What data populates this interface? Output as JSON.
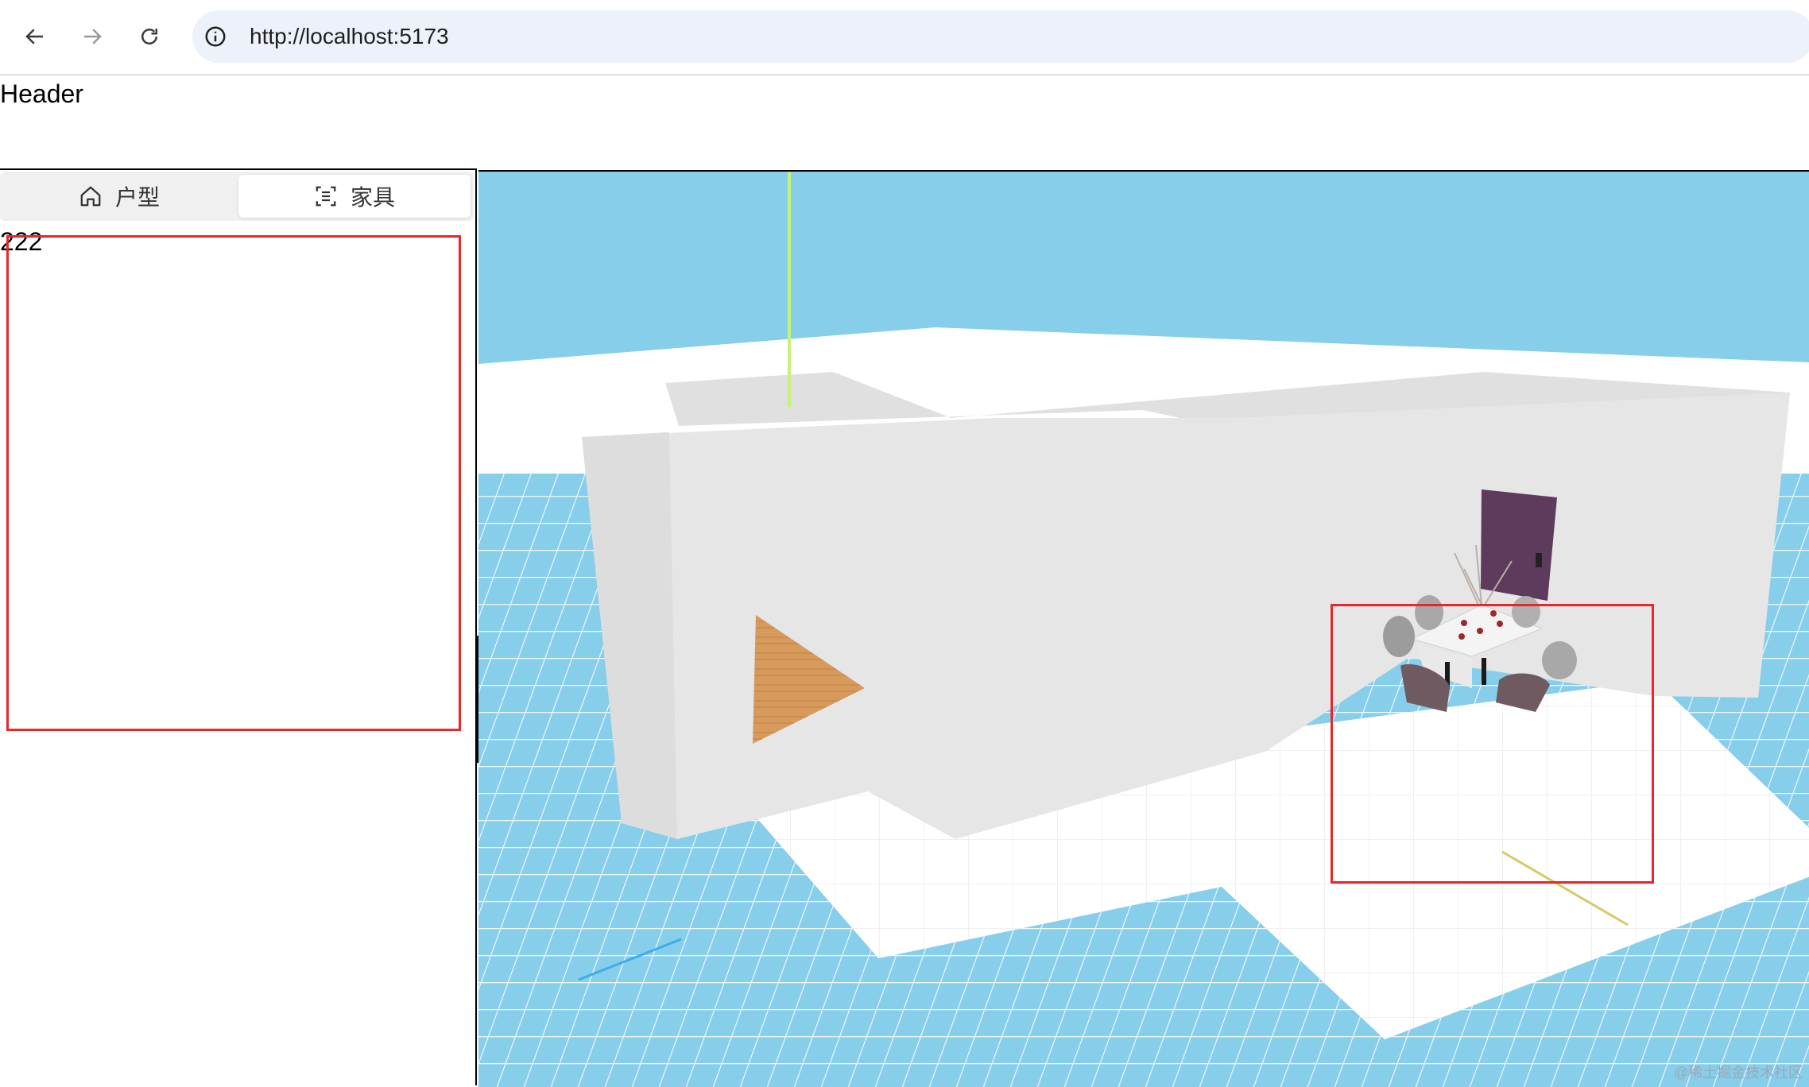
{
  "browser": {
    "url": "http://localhost:5173",
    "back_icon": "arrow-left-icon",
    "forward_icon": "arrow-right-icon",
    "reload_icon": "reload-icon",
    "info_icon": "info-circle-icon"
  },
  "header": {
    "text": "Header"
  },
  "sidebar": {
    "tabs": [
      {
        "label": "户型",
        "icon": "house-icon",
        "selected": false
      },
      {
        "label": "家具",
        "icon": "scan-icon",
        "selected": true
      }
    ],
    "content_text": "222"
  },
  "viewport": {
    "watermark": "@稀土掘金技术社区"
  },
  "colors": {
    "sky": "#87ceea",
    "grid_line": "#ffffff",
    "wall": "#e6e6e6",
    "floor": "#ffffff",
    "wood_floor": "#d69a5c",
    "door": "#5e3a5c",
    "highlight": "#e8262b"
  }
}
